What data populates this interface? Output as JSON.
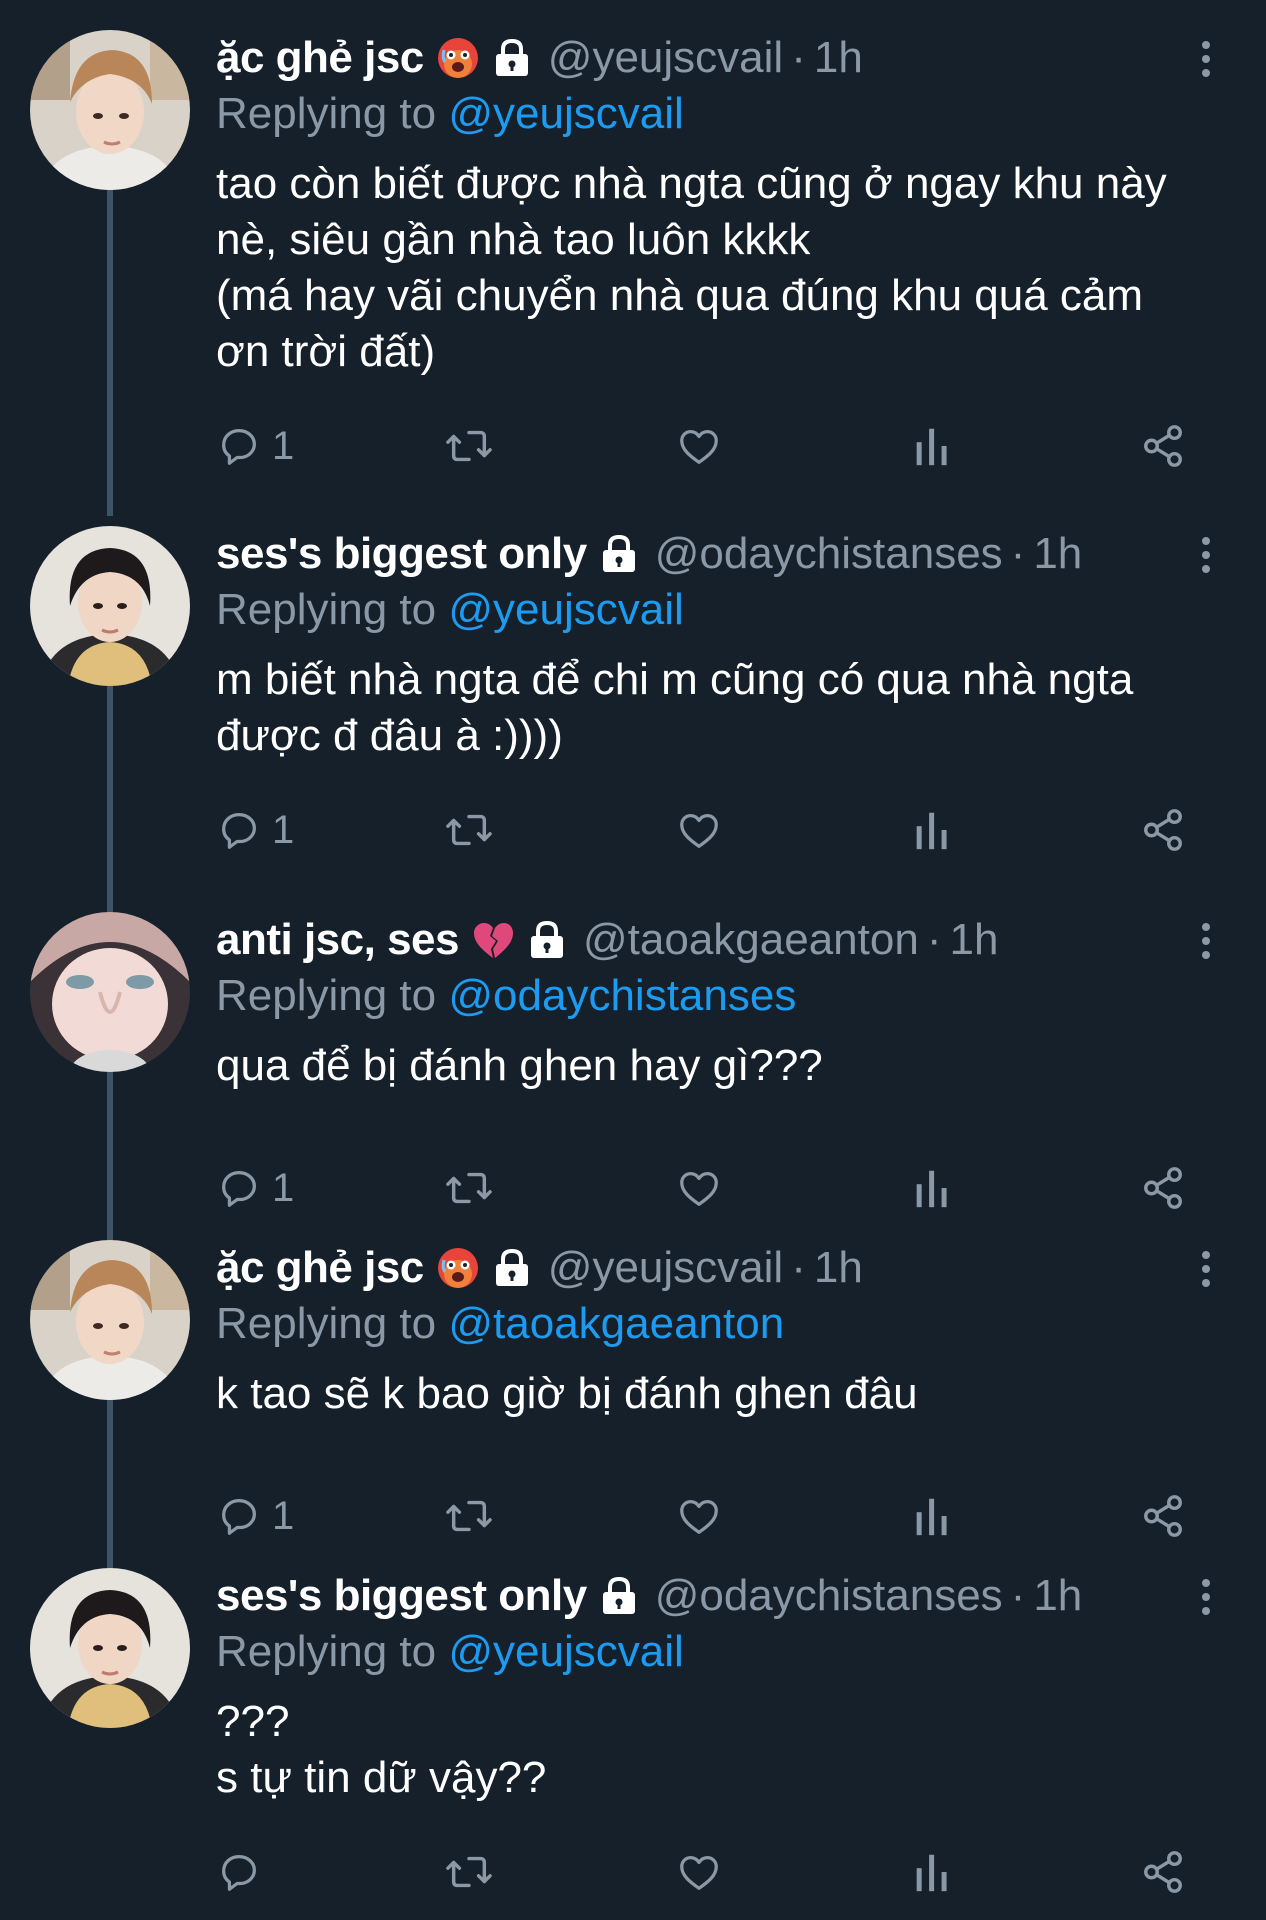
{
  "tweets": [
    {
      "display_name": "ặc ghẻ jsc",
      "badge": "hot-face-emoji",
      "locked": true,
      "handle": "@yeujscvail",
      "separator": "·",
      "time": "1h",
      "replying_prefix": "Replying to",
      "replying_handle": "@yeujscvail",
      "text_lines": [
        "tao còn biết được nhà ngta cũng ở ngay khu này",
        "nè, siêu gần nhà tao luôn kkkk",
        "(má hay vãi chuyển nhà qua đúng khu quá cảm",
        "ơn trời đất)"
      ],
      "reply_count": "1"
    },
    {
      "display_name": "ses's biggest only",
      "badge": "",
      "locked": true,
      "handle": "@odaychistanses",
      "separator": "·",
      "time": "1h",
      "replying_prefix": "Replying to",
      "replying_handle": "@yeujscvail",
      "text_lines": [
        "m biết nhà ngta để chi m cũng có qua nhà ngta",
        "được đ đâu à :))))"
      ],
      "reply_count": "1"
    },
    {
      "display_name": "anti jsc, ses",
      "badge": "broken-heart-emoji",
      "locked": true,
      "handle": "@taoakgaeanton",
      "separator": "·",
      "time": "1h",
      "replying_prefix": "Replying to",
      "replying_handle": "@odaychistanses",
      "text_lines": [
        "qua để bị đánh ghen hay gì???"
      ],
      "reply_count": "1"
    },
    {
      "display_name": "ặc ghẻ jsc",
      "badge": "hot-face-emoji",
      "locked": true,
      "handle": "@yeujscvail",
      "separator": "·",
      "time": "1h",
      "replying_prefix": "Replying to",
      "replying_handle": "@taoakgaeanton",
      "text_lines": [
        "k tao sẽ k bao giờ bị đánh ghen đâu"
      ],
      "reply_count": "1"
    },
    {
      "display_name": "ses's biggest only",
      "badge": "",
      "locked": true,
      "handle": "@odaychistanses",
      "separator": "·",
      "time": "1h",
      "replying_prefix": "Replying to",
      "replying_handle": "@yeujscvail",
      "text_lines": [
        "???",
        "s tự tin dữ vậy??"
      ],
      "reply_count": ""
    }
  ],
  "icons": {
    "reply": "reply-icon",
    "retweet": "retweet-icon",
    "like": "like-icon",
    "views": "views-icon",
    "share": "share-icon",
    "more": "more-icon",
    "lock": "lock-icon"
  },
  "colors": {
    "background": "#15202b",
    "text": "#ffffff",
    "secondary": "#8b98a5",
    "link": "#1d9bf0",
    "thread_line": "#3d5466"
  }
}
